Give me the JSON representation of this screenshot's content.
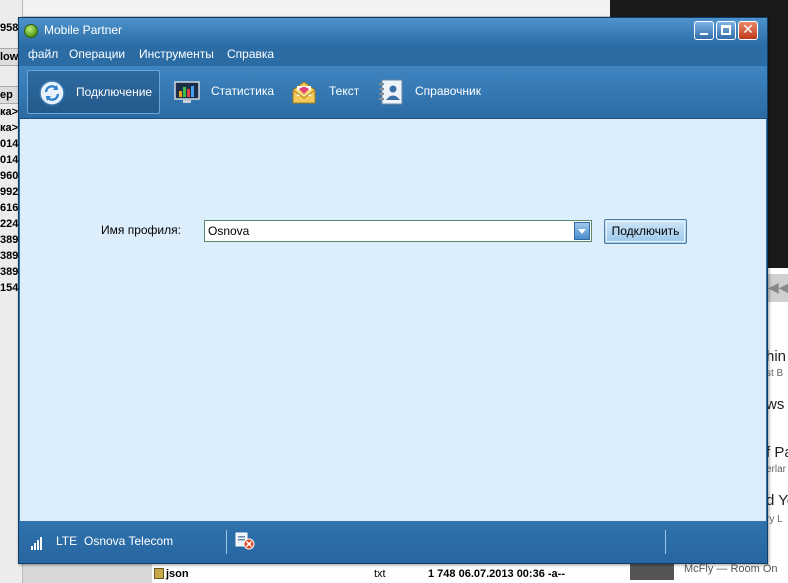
{
  "background": {
    "left_cells": [
      "958",
      "low",
      "ер",
      "ка>",
      "ка>",
      "014",
      "014",
      "960",
      "992",
      "616",
      "224",
      "389",
      "389",
      "389",
      "154"
    ],
    "right_lines": [
      {
        "text": "hin",
        "kind": "big"
      },
      {
        "text": "st B",
        "kind": "small"
      },
      {
        "text": "ws",
        "kind": "big"
      },
      {
        "text": "f Pa",
        "kind": "big"
      },
      {
        "text": "erlar",
        "kind": "small"
      },
      {
        "text": "d Yo",
        "kind": "big"
      },
      {
        "text": "ry L",
        "kind": "small"
      }
    ],
    "bottom_file": {
      "name": "json",
      "type": "txt",
      "size_date": "1 748 06.07.2013 00:36 -a--"
    },
    "bottom_song": "McFly — Room On"
  },
  "window": {
    "title": "Mobile Partner",
    "menu": [
      "файл",
      "Операции",
      "Инструменты",
      "Справка"
    ],
    "tabs": [
      {
        "label": "Подключение",
        "icon": "connection-icon",
        "active": true
      },
      {
        "label": "Статистика",
        "icon": "statistics-icon",
        "active": false
      },
      {
        "label": "Текст",
        "icon": "message-icon",
        "active": false
      },
      {
        "label": "Справочник",
        "icon": "contacts-icon",
        "active": false
      }
    ],
    "profile": {
      "label": "Имя профиля:",
      "value": "Osnova"
    },
    "connect_label": "Подключить",
    "status": {
      "network_type": "LTE",
      "operator": "Osnova Telecom"
    }
  }
}
